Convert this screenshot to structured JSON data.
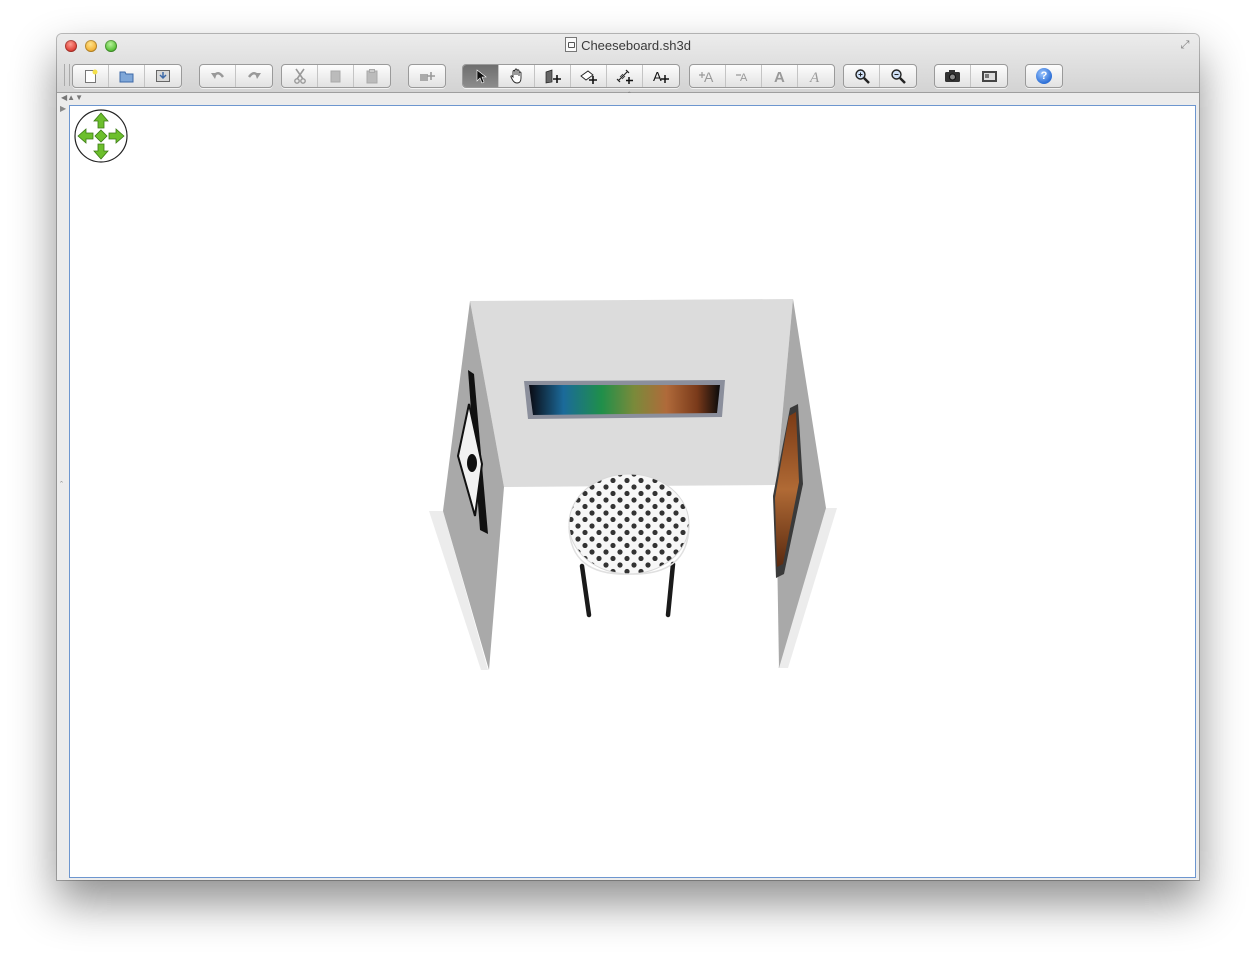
{
  "window": {
    "title": "Cheeseboard.sh3d"
  },
  "toolbar": {
    "buttons": [
      {
        "name": "new-home-button",
        "icon": "new-document-icon"
      },
      {
        "name": "open-button",
        "icon": "open-folder-icon"
      },
      {
        "name": "save-button",
        "icon": "save-icon"
      },
      {
        "name": "undo-button",
        "icon": "undo-icon"
      },
      {
        "name": "redo-button",
        "icon": "redo-icon"
      },
      {
        "name": "cut-button",
        "icon": "scissors-icon"
      },
      {
        "name": "copy-button",
        "icon": "copy-icon"
      },
      {
        "name": "paste-button",
        "icon": "paste-icon"
      },
      {
        "name": "add-furniture-button",
        "icon": "add-furniture-icon"
      },
      {
        "name": "select-mode-button",
        "icon": "arrow-pointer-icon",
        "active": true
      },
      {
        "name": "pan-mode-button",
        "icon": "hand-icon"
      },
      {
        "name": "create-walls-button",
        "icon": "create-walls-icon"
      },
      {
        "name": "create-rooms-button",
        "icon": "create-rooms-icon"
      },
      {
        "name": "create-dimensions-button",
        "icon": "create-dimensions-icon"
      },
      {
        "name": "add-text-button",
        "icon": "add-text-icon"
      },
      {
        "name": "increase-text-size-button",
        "icon": "text-increase-icon"
      },
      {
        "name": "decrease-text-size-button",
        "icon": "text-decrease-icon"
      },
      {
        "name": "bold-text-button",
        "icon": "bold-icon"
      },
      {
        "name": "italic-text-button",
        "icon": "italic-icon"
      },
      {
        "name": "zoom-in-button",
        "icon": "zoom-in-icon"
      },
      {
        "name": "zoom-out-button",
        "icon": "zoom-out-icon"
      },
      {
        "name": "create-photo-button",
        "icon": "camera-icon"
      },
      {
        "name": "create-video-button",
        "icon": "video-icon"
      },
      {
        "name": "help-button",
        "icon": "help-icon"
      }
    ],
    "help_glyph": "?",
    "text_glyph": "A"
  },
  "viewport": {
    "navigation_widget": "navigation-arrows-icon",
    "scene": "3d-room-view",
    "colors": {
      "wall_back": "#dcdcdc",
      "wall_side": "#a9a9a9",
      "wall_edge": "#ececec",
      "table_legs": "#1a1a1a",
      "table_dots": "#333333",
      "nav_green": "#6cbf2c"
    }
  }
}
